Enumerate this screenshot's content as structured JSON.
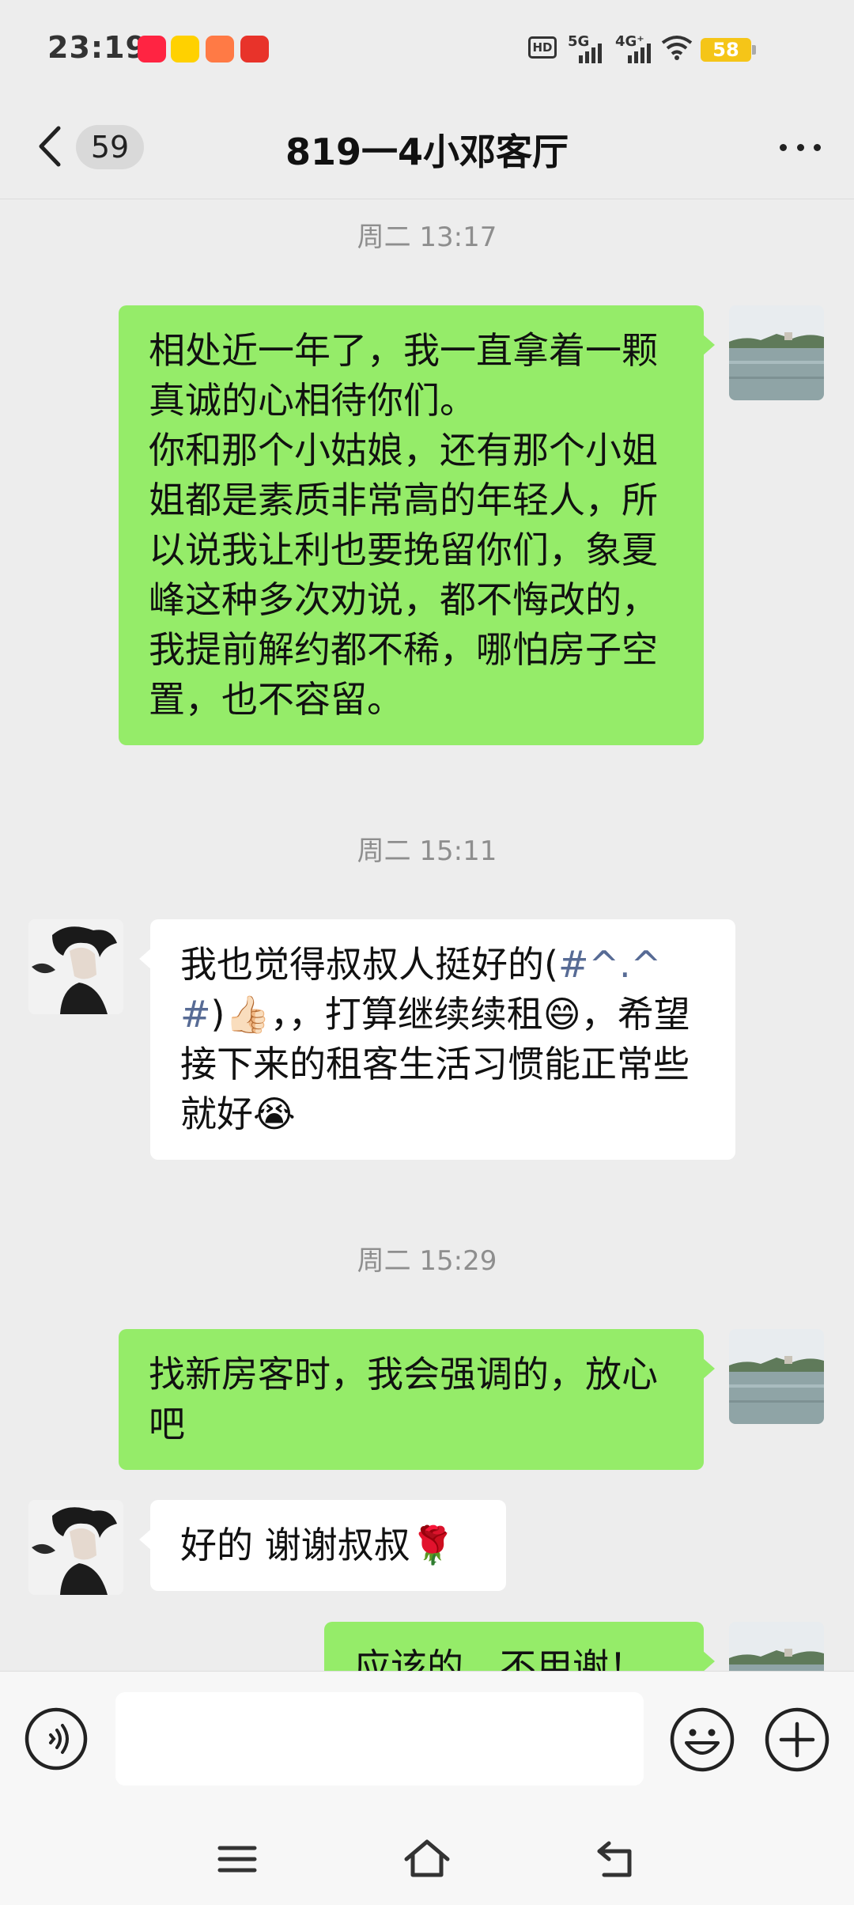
{
  "status_bar": {
    "time": "23:19",
    "battery": "58",
    "network_1": "HD",
    "network_2": "5G",
    "network_3": "4G⁺"
  },
  "header": {
    "unread_count": "59",
    "title": "819一4小邓客厅"
  },
  "messages": [
    {
      "type": "time",
      "text": "周二 13:17"
    },
    {
      "type": "sent",
      "text": "相处近一年了，我一直拿着一颗真诚的心相待你们。\n你和那个小姑娘，还有那个小姐姐都是素质非常高的年轻人，所以说我让利也要挽留你们，象夏峰这种多次劝说，都不悔改的，我提前解约都不稀，哪怕房子空置，也不容留。"
    },
    {
      "type": "time",
      "text": "周二 15:11"
    },
    {
      "type": "received",
      "text_a": "我也觉得叔叔人挺好的(",
      "tag": "#^.^#",
      "text_b": ")",
      "emoji_1": "👍🏻",
      "text_c": "，，打算继续续租",
      "emoji_2": "😄",
      "text_d": "，希望接下来的租客生活习惯能正常些就好",
      "emoji_3": "😭"
    },
    {
      "type": "time",
      "text": "周二 15:29"
    },
    {
      "type": "sent",
      "text": "找新房客时，我会强调的，放心吧"
    },
    {
      "type": "received",
      "text": "好的 谢谢叔叔",
      "emoji": "🌹"
    },
    {
      "type": "sent",
      "text": "应该的，不用谢！"
    }
  ],
  "input": {
    "placeholder": ""
  },
  "colors": {
    "sent_bubble": "#95ec69",
    "received_bubble": "#ffffff",
    "background": "#ededed",
    "tag_blue": "#576b95"
  },
  "icons": [
    "back-icon",
    "more-icon",
    "voice-icon",
    "emoji-icon",
    "plus-icon",
    "menu-icon",
    "home-icon",
    "return-icon"
  ]
}
